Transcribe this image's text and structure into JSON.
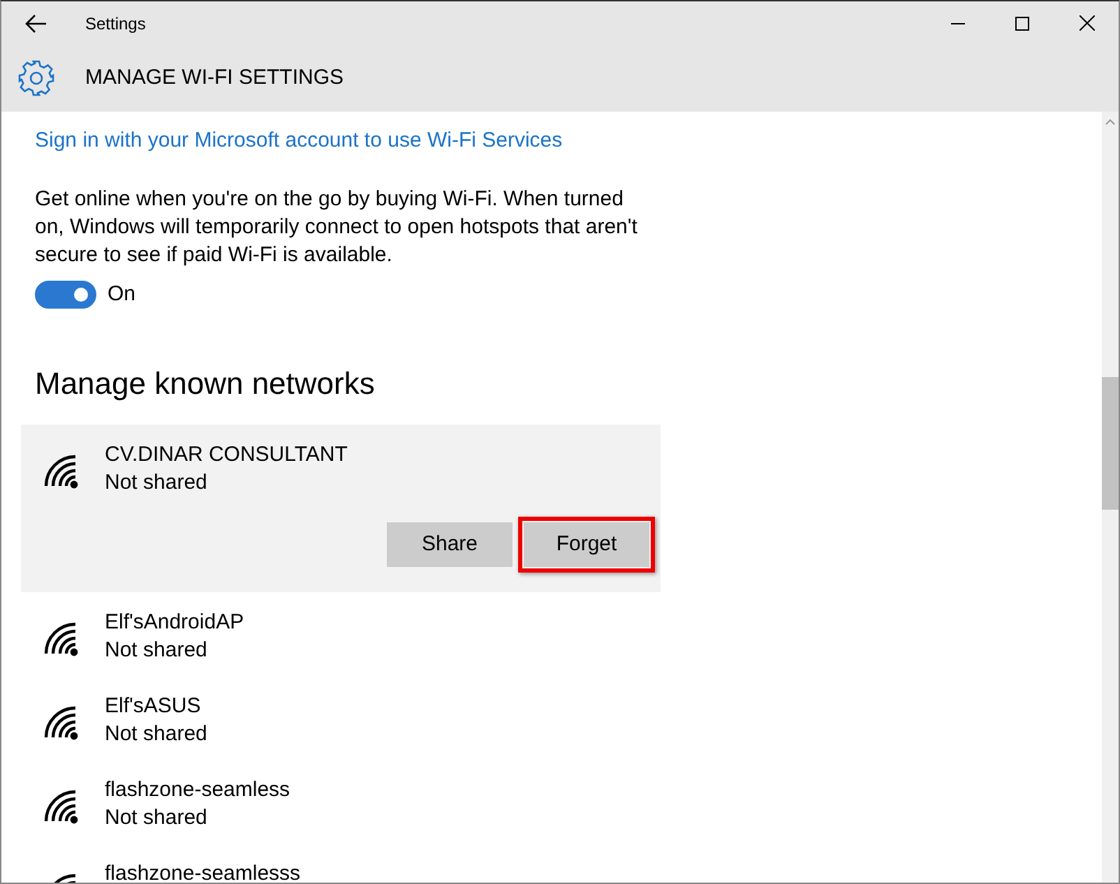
{
  "window": {
    "title": "Settings"
  },
  "header": {
    "title": "MANAGE WI-FI SETTINGS"
  },
  "signin_link": "Sign in with your Microsoft account to use Wi-Fi Services",
  "description": "Get online when you're on the go by buying Wi-Fi. When turned on, Windows will temporarily connect to open hotspots that aren't secure to see if paid Wi-Fi is available.",
  "paid_wifi_toggle": {
    "on": true,
    "label": "On"
  },
  "section_title": "Manage known networks",
  "networks": [
    {
      "name": "CV.DINAR CONSULTANT",
      "status": "Not shared",
      "expanded": true,
      "buttons": [
        {
          "label": "Share",
          "highlighted": false
        },
        {
          "label": "Forget",
          "highlighted": true
        }
      ]
    },
    {
      "name": "Elf'sAndroidAP",
      "status": "Not shared",
      "expanded": false
    },
    {
      "name": "Elf'sASUS",
      "status": "Not shared",
      "expanded": false
    },
    {
      "name": "flashzone-seamless",
      "status": "Not shared",
      "expanded": false
    },
    {
      "name": "flashzone-seamlesss",
      "expanded": false
    }
  ]
}
